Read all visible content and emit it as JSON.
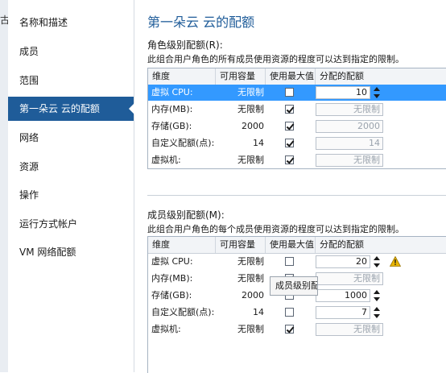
{
  "left_fragment": "古",
  "sidebar": {
    "items": [
      {
        "label": "名称和描述"
      },
      {
        "label": "成员"
      },
      {
        "label": "范围"
      },
      {
        "label": "第一朵云 云的配额"
      },
      {
        "label": "网络"
      },
      {
        "label": "资源"
      },
      {
        "label": "操作"
      },
      {
        "label": "运行方式帐户"
      },
      {
        "label": "VM 网络配额"
      }
    ],
    "active_index": 3
  },
  "main": {
    "title": "第一朵云 云的配额",
    "role_section": {
      "title": "角色级别配额(R):",
      "description": "此组合用户角色的所有成员使用资源的程度可以达到指定的限制。",
      "headers": [
        "维度",
        "可用容量",
        "使用最大值",
        "分配的配额"
      ],
      "rows": [
        {
          "dim": "虚拟 CPU:",
          "cap": "无限制",
          "max": false,
          "alloc": "10",
          "enabled": true,
          "selected": true
        },
        {
          "dim": "内存(MB):",
          "cap": "无限制",
          "max": true,
          "alloc": "无限制",
          "enabled": false
        },
        {
          "dim": "存储(GB):",
          "cap": "2000",
          "max": true,
          "alloc": "2000",
          "enabled": false
        },
        {
          "dim": "自定义配额(点):",
          "cap": "14",
          "max": true,
          "alloc": "14",
          "enabled": false
        },
        {
          "dim": "虚拟机:",
          "cap": "无限制",
          "max": true,
          "alloc": "无限制",
          "enabled": false
        }
      ]
    },
    "member_section": {
      "title": "成员级别配额(M):",
      "description": "此组合用户角色的每个成员使用资源的程度可以达到指定的限制。",
      "headers": [
        "维度",
        "可用容量",
        "使用最大值",
        "分配的配额"
      ],
      "rows": [
        {
          "dim": "虚拟 CPU:",
          "cap": "无限制",
          "max": false,
          "alloc": "20",
          "enabled": true,
          "warning": true
        },
        {
          "dim": "内存(MB):",
          "cap": "无限制",
          "max": true,
          "alloc": "无限制",
          "enabled": false
        },
        {
          "dim": "存储(GB):",
          "cap": "2000",
          "max": false,
          "alloc": "1000",
          "enabled": true
        },
        {
          "dim": "自定义配额(点):",
          "cap": "14",
          "max": false,
          "alloc": "7",
          "enabled": true
        },
        {
          "dim": "虚拟机:",
          "cap": "无限制",
          "max": true,
          "alloc": "无限制",
          "enabled": false
        }
      ]
    },
    "tooltip": "成员级别配"
  },
  "colors": {
    "accent": "#1f5c99",
    "selection": "#3399ff",
    "warning": "#e8b400"
  }
}
